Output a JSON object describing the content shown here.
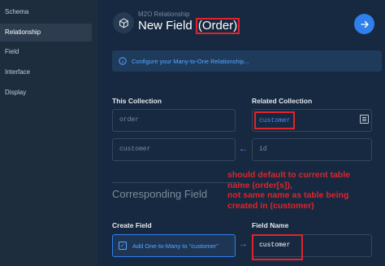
{
  "sidebar": {
    "items": [
      {
        "label": "Schema"
      },
      {
        "label": "Relationship"
      },
      {
        "label": "Field"
      },
      {
        "label": "Interface"
      },
      {
        "label": "Display"
      }
    ]
  },
  "header": {
    "breadcrumb": "M2O Relationship",
    "title_prefix": "New Field ",
    "title_highlight": "(Order)"
  },
  "notice": {
    "text": "Configure your Many-to-One Relationship..."
  },
  "form": {
    "this_collection_label": "This Collection",
    "related_collection_label": "Related Collection",
    "this_collection_value": "order",
    "related_collection_value": "customer",
    "this_field_value": "customer",
    "related_field_value": "id",
    "corresponding_title": "Corresponding Field",
    "create_field_label": "Create Field",
    "field_name_label": "Field Name",
    "create_field_option": "Add One-to-Many to \"customer\"",
    "field_name_value": "customer"
  },
  "annotation": {
    "lines": [
      "should default to current table",
      "name (order[s]),",
      "not same name as table being",
      "created in (customer)"
    ]
  },
  "colors": {
    "accent": "#2f80ed",
    "link": "#4a8cff",
    "annotation": "#e0242c",
    "background": "#172940",
    "sidebar": "#1e2d3d"
  }
}
